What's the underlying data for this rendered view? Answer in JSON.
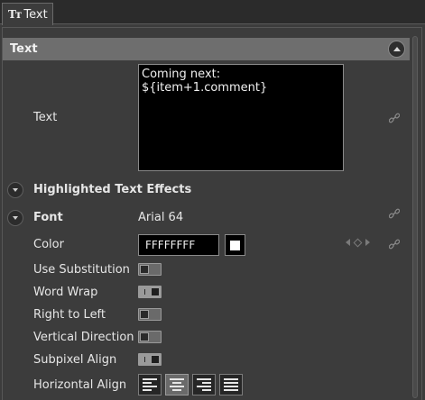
{
  "tab": {
    "icon": "Tт",
    "label": "Text"
  },
  "section": {
    "title": "Text"
  },
  "text_field": {
    "label": "Text",
    "value": "Coming next: ${item+1.comment}"
  },
  "highlighted": {
    "label": "Highlighted Text Effects"
  },
  "font": {
    "label": "Font",
    "value": "Arial 64"
  },
  "color": {
    "label": "Color",
    "hex": "FFFFFFFF",
    "swatch": "#ffffff"
  },
  "toggles": [
    {
      "label": "Use Substitution",
      "state": "off"
    },
    {
      "label": "Word Wrap",
      "state": "on"
    },
    {
      "label": "Right to Left",
      "state": "off"
    },
    {
      "label": "Vertical Direction",
      "state": "off"
    },
    {
      "label": "Subpixel Align",
      "state": "on"
    }
  ],
  "horizontal_align": {
    "label": "Horizontal Align",
    "options": [
      "left",
      "center",
      "right",
      "justify"
    ],
    "selected": "center"
  },
  "icons": {
    "link": "link-icon",
    "collapse": "chevron-up-icon",
    "expand": "chevron-down-icon",
    "keyframe": "keyframe-diamond-icon"
  }
}
